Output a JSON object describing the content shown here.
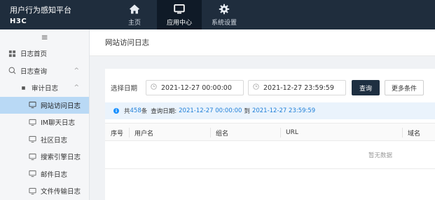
{
  "brand": {
    "title": "用户行为感知平台",
    "logo": "H3C"
  },
  "nav": [
    {
      "label": "主页",
      "icon": "home-icon"
    },
    {
      "label": "应用中心",
      "icon": "monitor-icon",
      "active": true
    },
    {
      "label": "系统设置",
      "icon": "gear-icon"
    }
  ],
  "sidebar": {
    "collapse_glyph": "≡",
    "items": [
      {
        "label": "日志首页",
        "icon": "grid-icon"
      },
      {
        "label": "日志查询",
        "icon": "search-icon",
        "arrow": "^"
      },
      {
        "label": "审计日志",
        "icon": "bullet-icon",
        "arrow": "^"
      },
      {
        "label": "网站访问日志",
        "icon": "monitor-icon",
        "active": true
      },
      {
        "label": "IM聊天日志",
        "icon": "monitor-icon"
      },
      {
        "label": "社区日志",
        "icon": "monitor-icon"
      },
      {
        "label": "搜索引擎日志",
        "icon": "monitor-icon"
      },
      {
        "label": "邮件日志",
        "icon": "monitor-icon"
      },
      {
        "label": "文件传输日志",
        "icon": "monitor-icon"
      }
    ]
  },
  "page": {
    "title": "网站访问日志"
  },
  "filter": {
    "label": "选择日期",
    "start": "2021-12-27 00:00:00",
    "end": "2021-12-27 23:59:59",
    "query_button": "查询",
    "more_button": "更多条件"
  },
  "summary": {
    "prefix": "共",
    "count": "458",
    "count_unit": "条",
    "date_label": "查询日期:",
    "start": "2021-12-27 00:00:00",
    "to": "到",
    "end": "2021-12-27 23:59:59"
  },
  "table": {
    "columns": [
      "序号",
      "用户名",
      "组名",
      "URL",
      "域名"
    ],
    "empty_text": "暂无数据"
  }
}
